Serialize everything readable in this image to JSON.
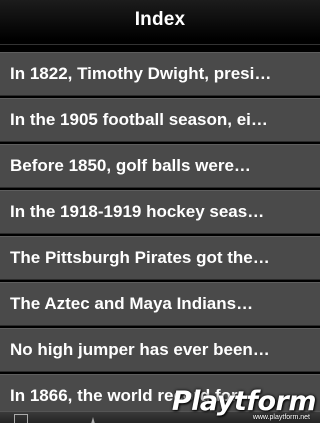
{
  "nav": {
    "title": "Index"
  },
  "list": {
    "items": [
      {
        "label": "In 1822, Timothy Dwight, presi…"
      },
      {
        "label": "In the 1905 football season, ei…"
      },
      {
        "label": "Before 1850, golf balls were…"
      },
      {
        "label": "In the 1918-1919 hockey seas…"
      },
      {
        "label": "The Pittsburgh Pirates got the…"
      },
      {
        "label": "The Aztec and Maya Indians…"
      },
      {
        "label": "No high jumper has ever been…"
      },
      {
        "label": "In 1866, the world record for"
      }
    ]
  },
  "tab_bar": {
    "icons": [
      "index-icon",
      "favorites-icon"
    ]
  },
  "watermark": {
    "logo": "Playtform",
    "url": "www.playtform.net"
  },
  "colors": {
    "row_background": "#4a4a4a",
    "nav_background": "#111111",
    "text": "#ffffff"
  }
}
